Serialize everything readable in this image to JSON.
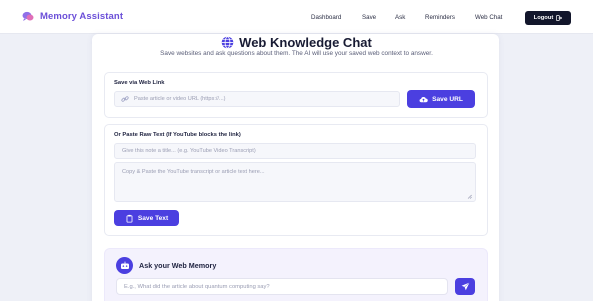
{
  "app": {
    "brand_name": "Memory Assistant",
    "brand_color": "#6b4fd8"
  },
  "nav": {
    "links": [
      "Dashboard",
      "Save",
      "Ask",
      "Reminders",
      "Web Chat"
    ],
    "logout_label": "Logout"
  },
  "header": {
    "title": "Web Knowledge Chat",
    "subtitle": "Save websites and ask questions about them. The AI will use your saved web context to answer."
  },
  "save_link": {
    "label": "Save via Web Link",
    "url_placeholder": "Paste article or video URL (https://...)",
    "button_label": "Save URL"
  },
  "raw_text": {
    "label": "Or Paste Raw Text (If YouTube blocks the link)",
    "title_placeholder": "Give this note a title... (e.g. YouTube Video Transcript)",
    "body_placeholder": "Copy & Paste the YouTube transcript or article text here...",
    "button_label": "Save Text"
  },
  "ask": {
    "title": "Ask your Web Memory",
    "question_placeholder": "E.g., What did the article about quantum computing say?"
  },
  "colors": {
    "accent": "#4b3fe0",
    "dark_button": "#12162b",
    "background": "#eef0f7"
  },
  "icons": {
    "brand": "chat-bubbles-icon",
    "title": "globe-icon",
    "url_field": "link-icon",
    "save_url": "cloud-upload-icon",
    "save_text": "clipboard-icon",
    "chat": "robot-icon",
    "send": "paper-plane-icon",
    "logout": "logout-icon"
  }
}
